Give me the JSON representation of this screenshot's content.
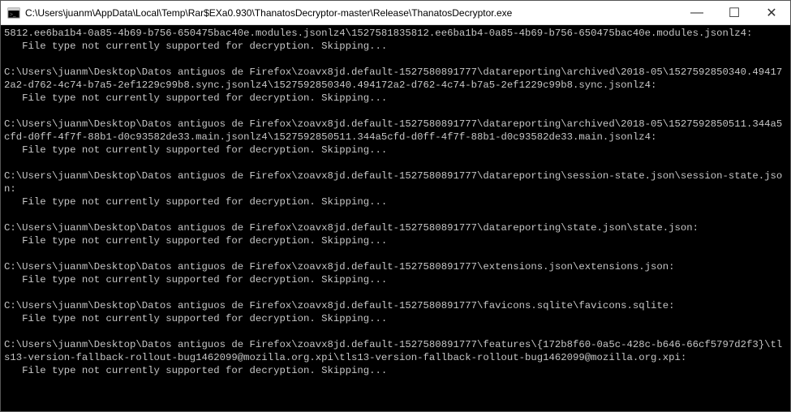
{
  "window": {
    "title": "C:\\Users\\juanm\\AppData\\Local\\Temp\\Rar$EXa0.930\\ThanatosDecryptor-master\\Release\\ThanatosDecryptor.exe",
    "controls": {
      "minimize_glyph": "—",
      "maximize_glyph": "☐",
      "close_glyph": "✕"
    },
    "icon_name": "console-icon"
  },
  "console": {
    "skip_msg": "   File type not currently supported for decryption. Skipping...",
    "entries": [
      {
        "path": "5812.ee6ba1b4-0a85-4b69-b756-650475bac40e.modules.jsonlz4\\1527581835812.ee6ba1b4-0a85-4b69-b756-650475bac40e.modules.jsonlz4:"
      },
      {
        "path": "C:\\Users\\juanm\\Desktop\\Datos antiguos de Firefox\\zoavx8jd.default-1527580891777\\datareporting\\archived\\2018-05\\1527592850340.494172a2-d762-4c74-b7a5-2ef1229c99b8.sync.jsonlz4\\1527592850340.494172a2-d762-4c74-b7a5-2ef1229c99b8.sync.jsonlz4:"
      },
      {
        "path": "C:\\Users\\juanm\\Desktop\\Datos antiguos de Firefox\\zoavx8jd.default-1527580891777\\datareporting\\archived\\2018-05\\1527592850511.344a5cfd-d0ff-4f7f-88b1-d0c93582de33.main.jsonlz4\\1527592850511.344a5cfd-d0ff-4f7f-88b1-d0c93582de33.main.jsonlz4:"
      },
      {
        "path": "C:\\Users\\juanm\\Desktop\\Datos antiguos de Firefox\\zoavx8jd.default-1527580891777\\datareporting\\session-state.json\\session-state.json:"
      },
      {
        "path": "C:\\Users\\juanm\\Desktop\\Datos antiguos de Firefox\\zoavx8jd.default-1527580891777\\datareporting\\state.json\\state.json:"
      },
      {
        "path": "C:\\Users\\juanm\\Desktop\\Datos antiguos de Firefox\\zoavx8jd.default-1527580891777\\extensions.json\\extensions.json:"
      },
      {
        "path": "C:\\Users\\juanm\\Desktop\\Datos antiguos de Firefox\\zoavx8jd.default-1527580891777\\favicons.sqlite\\favicons.sqlite:"
      },
      {
        "path": "C:\\Users\\juanm\\Desktop\\Datos antiguos de Firefox\\zoavx8jd.default-1527580891777\\features\\{172b8f60-0a5c-428c-b646-66cf5797d2f3}\\tls13-version-fallback-rollout-bug1462099@mozilla.org.xpi\\tls13-version-fallback-rollout-bug1462099@mozilla.org.xpi:"
      }
    ]
  }
}
